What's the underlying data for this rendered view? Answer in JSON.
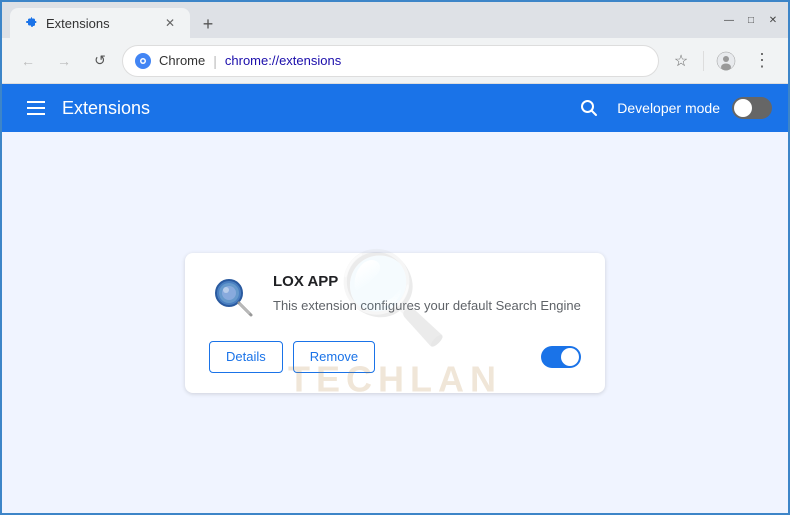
{
  "window": {
    "title": "Extensions",
    "tab_label": "Extensions",
    "close_btn": "✕",
    "new_tab_btn": "+"
  },
  "controls": {
    "minimize": "—",
    "maximize": "□",
    "close": "✕"
  },
  "addressbar": {
    "back_icon": "←",
    "forward_icon": "→",
    "reload_icon": "↺",
    "site_name": "Chrome",
    "url_display": "chrome://extensions",
    "url_prefix": "chrome://",
    "url_path": "extensions",
    "bookmark_icon": "☆",
    "profile_icon": "👤",
    "menu_icon": "⋮"
  },
  "extensions_header": {
    "title": "Extensions",
    "search_icon": "🔍",
    "dev_mode_label": "Developer mode"
  },
  "extension_card": {
    "name": "LOX APP",
    "description": "This extension configures your default Search Engine",
    "details_btn": "Details",
    "remove_btn": "Remove",
    "enabled": true
  },
  "watermark": {
    "text": "TECHLAN"
  }
}
